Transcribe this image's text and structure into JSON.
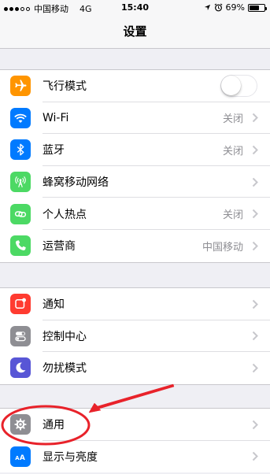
{
  "status_bar": {
    "carrier": "中国移动",
    "network": "4G",
    "time": "15:40",
    "battery": "69%",
    "battery_level": 0.69
  },
  "nav": {
    "title": "设置"
  },
  "group1": [
    {
      "label": "飞行模式",
      "icon": "airplane-icon",
      "color": "#ff9500",
      "toggle": false
    },
    {
      "label": "Wi-Fi",
      "icon": "wifi-icon",
      "color": "#007aff",
      "value": "关闭"
    },
    {
      "label": "蓝牙",
      "icon": "bluetooth-icon",
      "color": "#007aff",
      "value": "关闭"
    },
    {
      "label": "蜂窝移动网络",
      "icon": "cellular-icon",
      "color": "#4cd964"
    },
    {
      "label": "个人热点",
      "icon": "hotspot-icon",
      "color": "#4cd964",
      "value": "关闭"
    },
    {
      "label": "运营商",
      "icon": "phone-icon",
      "color": "#4cd964",
      "value": "中国移动"
    }
  ],
  "group2": [
    {
      "label": "通知",
      "icon": "notifications-icon",
      "color": "#ff3b30"
    },
    {
      "label": "控制中心",
      "icon": "control-center-icon",
      "color": "#8e8e93"
    },
    {
      "label": "勿扰模式",
      "icon": "moon-icon",
      "color": "#5856d6"
    }
  ],
  "group3": [
    {
      "label": "通用",
      "icon": "gear-icon",
      "color": "#8e8e93"
    },
    {
      "label": "显示与亮度",
      "icon": "display-icon",
      "color": "#007aff"
    }
  ],
  "annotation": {
    "color": "#e8222a"
  }
}
